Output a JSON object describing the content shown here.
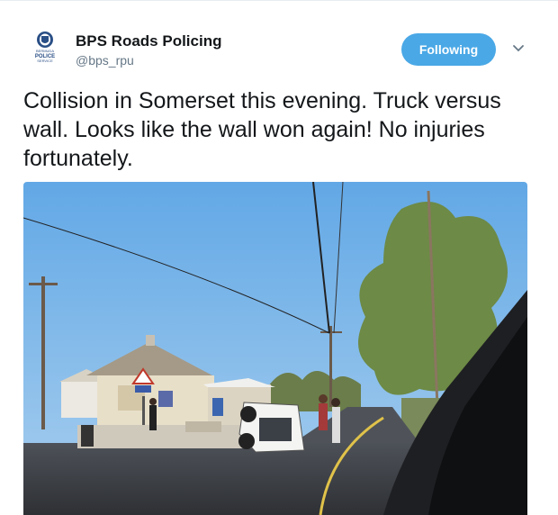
{
  "tweet": {
    "display_name": "BPS Roads Policing",
    "handle": "@bps_rpu",
    "follow_label": "Following",
    "text": "Collision in Somerset this evening.  Truck versus wall.  Looks like the wall won again!  No injuries fortunately.",
    "avatar_text_top": "BERMUDA",
    "avatar_text_mid": "POLICE",
    "avatar_text_bottom": "SERVICE"
  },
  "icons": {
    "caret": "chevron-down-icon",
    "avatar": "police-crest-logo"
  },
  "colors": {
    "follow_button": "#4aa8e6",
    "handle": "#657786",
    "text": "#14171a"
  }
}
